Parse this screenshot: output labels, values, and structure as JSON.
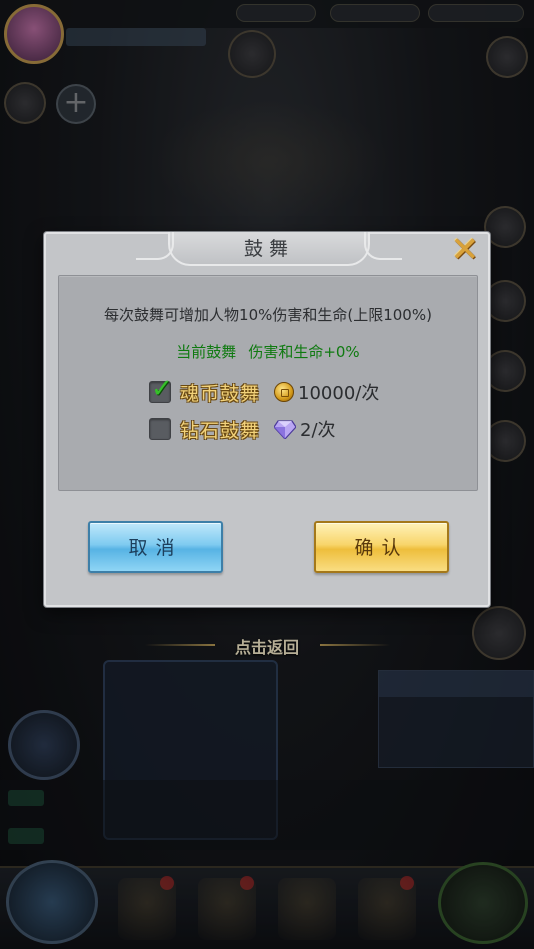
{
  "dialog": {
    "title": "鼓舞",
    "description": "每次鼓舞可增加人物10%伤害和生命(上限100%)",
    "current_label": "当前鼓舞",
    "current_value": "伤害和生命+0%",
    "options": [
      {
        "label": "魂币鼓舞",
        "checked": true,
        "cost_icon": "coin-icon",
        "cost": "10000/次"
      },
      {
        "label": "钻石鼓舞",
        "checked": false,
        "cost_icon": "diamond-icon",
        "cost": "2/次"
      }
    ],
    "cancel_label": "取消",
    "confirm_label": "确认",
    "close_icon": "close-icon"
  },
  "return_label": "点击返回",
  "colors": {
    "dialog_bg": "#c3c5c8",
    "inner_box": "#a9abaf",
    "current_text": "#0f7a10",
    "option_text": "#f2d27a",
    "cancel_button": "#7fcbf0",
    "confirm_button": "#f8d56b",
    "close_icon": "#d9a23a"
  }
}
